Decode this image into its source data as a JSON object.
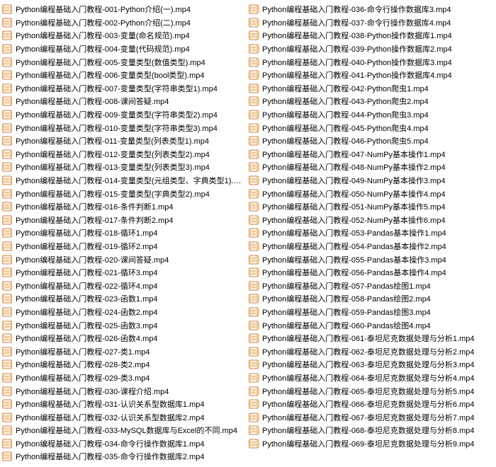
{
  "prefix": "Python编程基础入门教程-",
  "ext": ".mp4",
  "files": [
    {
      "n": "001",
      "t": "Python介绍(一)"
    },
    {
      "n": "002",
      "t": "Python介绍(二)"
    },
    {
      "n": "003",
      "t": "变量(命名规范)"
    },
    {
      "n": "004",
      "t": "变量(代码规范)"
    },
    {
      "n": "005",
      "t": "变量类型(数值类型)"
    },
    {
      "n": "006",
      "t": "变量类型(bool类型)"
    },
    {
      "n": "007",
      "t": "变量类型(字符串类型1)"
    },
    {
      "n": "008",
      "t": "课间答疑"
    },
    {
      "n": "009",
      "t": "变量类型(字符串类型2)"
    },
    {
      "n": "010",
      "t": "变量类型(字符串类型3)"
    },
    {
      "n": "011",
      "t": "变量类型(列表类型1)"
    },
    {
      "n": "012",
      "t": "变量类型(列表类型2)"
    },
    {
      "n": "013",
      "t": "变量类型(列表类型3)"
    },
    {
      "n": "014",
      "t": "变量类型(元组类型、字典类型1)"
    },
    {
      "n": "015",
      "t": "变量类型(字典类型2)"
    },
    {
      "n": "016",
      "t": "条件判断1"
    },
    {
      "n": "017",
      "t": "条件判断2"
    },
    {
      "n": "018",
      "t": "循环1"
    },
    {
      "n": "019",
      "t": "循环2"
    },
    {
      "n": "020",
      "t": "课间答疑"
    },
    {
      "n": "021",
      "t": "循环3"
    },
    {
      "n": "022",
      "t": "循环4"
    },
    {
      "n": "023",
      "t": "函数1"
    },
    {
      "n": "024",
      "t": "函数2"
    },
    {
      "n": "025",
      "t": "函数3"
    },
    {
      "n": "026",
      "t": "函数4"
    },
    {
      "n": "027",
      "t": "类1"
    },
    {
      "n": "028",
      "t": "类2"
    },
    {
      "n": "029",
      "t": "类3"
    },
    {
      "n": "030",
      "t": "课程介绍"
    },
    {
      "n": "031",
      "t": "认识关系型数据库1"
    },
    {
      "n": "032",
      "t": "认识关系型数据库2"
    },
    {
      "n": "033",
      "t": "MySQL数据库与Excel的不同"
    },
    {
      "n": "034",
      "t": "命令行操作数据库1"
    },
    {
      "n": "035",
      "t": "命令行操作数据库2"
    },
    {
      "n": "036",
      "t": "命令行操作数据库3"
    },
    {
      "n": "037",
      "t": "命令行操作数据库4"
    },
    {
      "n": "038",
      "t": "Python操作数据库1"
    },
    {
      "n": "039",
      "t": "Python操作数据库2"
    },
    {
      "n": "040",
      "t": "Python操作数据库3"
    },
    {
      "n": "041",
      "t": "Python操作数据库4"
    },
    {
      "n": "042",
      "t": "Python爬虫1"
    },
    {
      "n": "043",
      "t": "Python爬虫2"
    },
    {
      "n": "044",
      "t": "Python爬虫3"
    },
    {
      "n": "045",
      "t": "Python爬虫4"
    },
    {
      "n": "046",
      "t": "Python爬虫5"
    },
    {
      "n": "047",
      "t": "NumPy基本操作1"
    },
    {
      "n": "048",
      "t": "NumPy基本操作2"
    },
    {
      "n": "049",
      "t": "NumPy基本操作3"
    },
    {
      "n": "050",
      "t": "NumPy基本操作4"
    },
    {
      "n": "051",
      "t": "NumPy基本操作5"
    },
    {
      "n": "052",
      "t": "NumPy基本操作6"
    },
    {
      "n": "053",
      "t": "Pandas基本操作1"
    },
    {
      "n": "054",
      "t": "Pandas基本操作2"
    },
    {
      "n": "055",
      "t": "Pandas基本操作3"
    },
    {
      "n": "056",
      "t": "Pandas基本操作4"
    },
    {
      "n": "057",
      "t": "Pandas绘图1"
    },
    {
      "n": "058",
      "t": "Pandas绘图2"
    },
    {
      "n": "059",
      "t": "Pandas绘图3"
    },
    {
      "n": "060",
      "t": "Pandas绘图4"
    },
    {
      "n": "061",
      "t": "泰坦尼克数据处理与分析1"
    },
    {
      "n": "062",
      "t": "泰坦尼克数据处理与分析2"
    },
    {
      "n": "063",
      "t": "泰坦尼克数据处理与分析3"
    },
    {
      "n": "064",
      "t": "泰坦尼克数据处理与分析4"
    },
    {
      "n": "065",
      "t": "泰坦尼克数据处理与分析5"
    },
    {
      "n": "066",
      "t": "泰坦尼克数据处理与分析6"
    },
    {
      "n": "067",
      "t": "泰坦尼克数据处理与分析7"
    },
    {
      "n": "068",
      "t": "泰坦尼克数据处理与分析8"
    },
    {
      "n": "069",
      "t": "泰坦尼克数据处理与分析9"
    }
  ]
}
